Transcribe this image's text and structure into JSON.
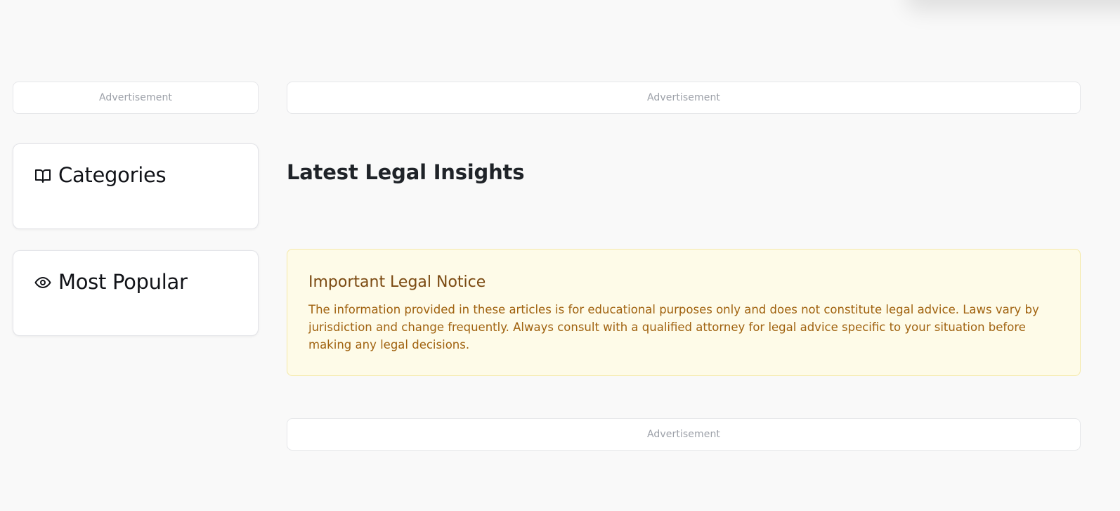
{
  "ads": {
    "sidebar_label": "Advertisement",
    "main_top_label": "Advertisement",
    "main_bottom_label": "Advertisement"
  },
  "sidebar": {
    "categories": {
      "title": "Categories",
      "icon": "book-open-icon"
    },
    "popular": {
      "title": "Most Popular",
      "icon": "eye-icon"
    }
  },
  "main": {
    "heading": "Latest Legal Insights",
    "notice": {
      "title": "Important Legal Notice",
      "text": "The information provided in these articles is for educational purposes only and does not constitute legal advice. Laws vary by jurisdiction and change frequently. Always consult with a qualified attorney for legal advice specific to your situation before making any legal decisions."
    }
  },
  "colors": {
    "notice_background": "#fefbe8",
    "notice_border": "#f5e9a8",
    "notice_title": "#7b4a12",
    "notice_text": "#a0620f"
  }
}
